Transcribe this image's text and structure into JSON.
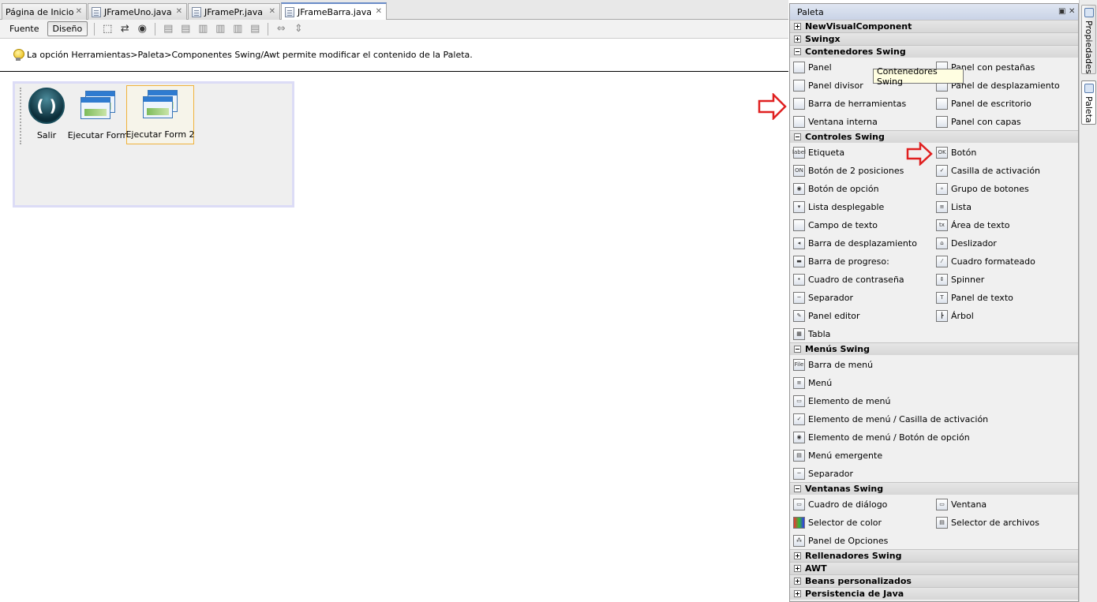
{
  "tabs": [
    {
      "label": "Página de Inicio",
      "icon": "none"
    },
    {
      "label": "JFrameUno.java",
      "icon": "java-file-icon"
    },
    {
      "label": "JFramePr.java",
      "icon": "java-file-icon"
    },
    {
      "label": "JFrameBarra.java",
      "icon": "java-file-icon",
      "active": true
    }
  ],
  "close_glyph": "✕",
  "toolbar": {
    "source_label": "Fuente",
    "design_label": "Diseño"
  },
  "hint": "La opción Herramientas>Paleta>Componentes Swing/Awt permite modificar el contenido de la Paleta.",
  "form": {
    "buttons": [
      {
        "label": "Salir",
        "icon": "exit-icon"
      },
      {
        "label": "Ejecutar Form",
        "icon": "window-icon"
      },
      {
        "label": "Ejecutar Form 2",
        "icon": "window-icon",
        "selected": true
      }
    ]
  },
  "palette": {
    "title": "Paleta",
    "categories": {
      "c0": "NewVisualComponent",
      "c1": "Swingx",
      "c2": "Contenedores Swing",
      "c3": "Controles Swing",
      "c4": "Menús Swing",
      "c5": "Ventanas Swing",
      "c6": "Rellenadores Swing",
      "c7": "AWT",
      "c8": "Beans personalizados",
      "c9": "Persistencia de Java"
    },
    "containers": [
      "Panel",
      "Panel con pestañas",
      "Panel divisor",
      "Panel de desplazamiento",
      "Barra de herramientas",
      "Panel de escritorio",
      "Ventana interna",
      "Panel con capas"
    ],
    "controls": [
      "Etiqueta",
      "Botón",
      "Botón de 2 posiciones",
      "Casilla de activación",
      "Botón de opción",
      "Grupo de botones",
      "Lista desplegable",
      "Lista",
      "Campo de texto",
      "Área de texto",
      "Barra de desplazamiento",
      "Deslizador",
      "Barra de progreso:",
      "Cuadro formateado",
      "Cuadro de contraseña",
      "Spinner",
      "Separador",
      "Panel de texto",
      "Panel editor",
      "Árbol",
      "Tabla"
    ],
    "control_icon_text": {
      "label": "label",
      "ok": "OK",
      "on": "ON",
      "tx": "tx"
    },
    "menus": [
      "Barra de menú",
      "Menú",
      "Elemento de menú",
      "Elemento de menú / Casilla de activación",
      "Elemento de menú / Botón de opción",
      "Menú emergente",
      "Separador"
    ],
    "menu_icon_text": {
      "file": "File"
    },
    "windows": [
      "Cuadro de diálogo",
      "Ventana",
      "Selector de color",
      "Selector de archivos",
      "Panel de Opciones"
    ]
  },
  "tooltip": "Contenedores Swing",
  "side_tabs": {
    "properties": "Propiedades",
    "palette": "Paleta"
  },
  "colors": {
    "arrow": "#e02020",
    "selection": "#f0b23c",
    "form_border": "#dcdcf6"
  }
}
